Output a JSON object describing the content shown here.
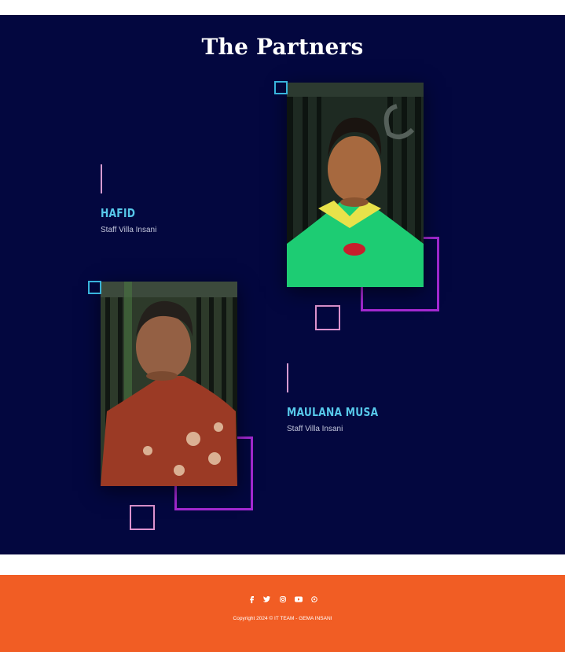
{
  "section": {
    "title": "The Partners"
  },
  "partners": [
    {
      "name": "HAFID",
      "role": "Staff Villa Insani"
    },
    {
      "name": "MAULANA MUSA",
      "role": "Staff Villa Insani"
    }
  ],
  "footer": {
    "social_icons": [
      "facebook-icon",
      "twitter-icon",
      "instagram-icon",
      "youtube-icon",
      "whatsapp-icon"
    ],
    "copyright": "Copyright 2024 © IT TEAM - GEMA INSANI"
  },
  "colors": {
    "section_bg": "#03073f",
    "footer_bg": "#f15d24",
    "name": "#57c8ea",
    "accent_purple": "#a429d2",
    "accent_pink": "#dd93cf",
    "accent_cyan": "#38b4dc"
  }
}
